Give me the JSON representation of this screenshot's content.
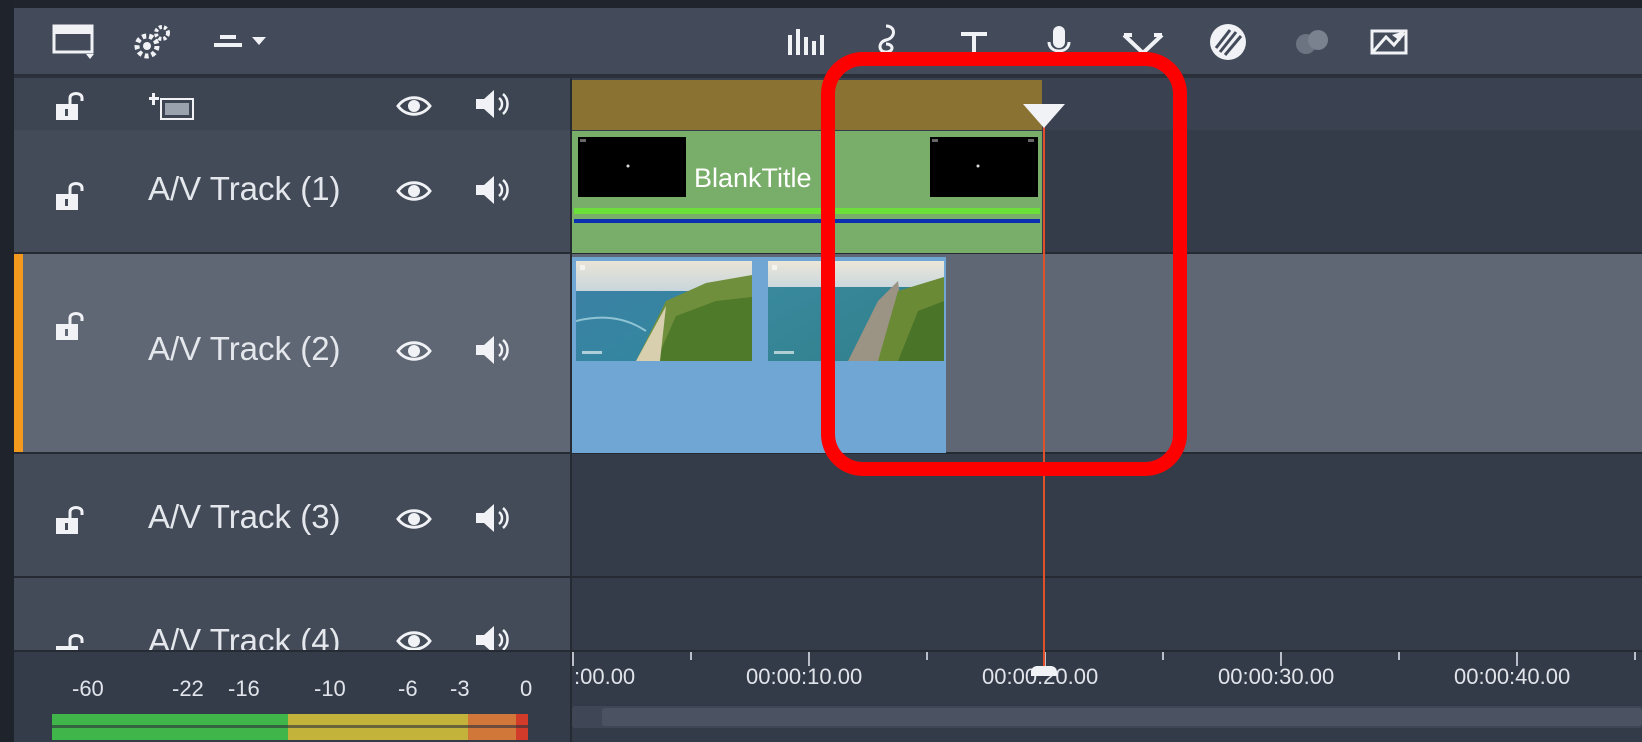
{
  "toolbar": {
    "left_icons": [
      "storyboard-view-icon",
      "settings-gear-icon",
      "track-options-dropdown-icon"
    ],
    "center_icons": [
      "audio-mixer-icon",
      "music-icon",
      "title-text-icon",
      "voiceover-mic-icon",
      "transition-icon",
      "color-grading-icon",
      "overlay-icon",
      "mask-icon"
    ]
  },
  "header": {
    "icons": [
      "lock-icon",
      "add-track-icon",
      "eye-icon",
      "speaker-icon"
    ]
  },
  "tracks": [
    {
      "name": "A/V Track (1)",
      "selected": false
    },
    {
      "name": "A/V Track (2)",
      "selected": true
    },
    {
      "name": "A/V Track (3)",
      "selected": false
    },
    {
      "name": "A/V Track (4)",
      "selected": false
    }
  ],
  "clips": {
    "title_clip_label": "BlankTitle"
  },
  "ruler": {
    "labels": [
      ":00.00",
      "00:00:10.00",
      "00:00:20.00",
      "00:00:30.00",
      "00:00:40.00"
    ]
  },
  "meter": {
    "labels": [
      "-60",
      "-22",
      "-16",
      "-10",
      "-6",
      "-3",
      "0"
    ]
  },
  "colors": {
    "annotation": "#ff0000",
    "playhead": "#e1502a",
    "title_clip": "#79ad6a",
    "video_clip": "#6fa6d4",
    "selected_accent": "#f39a1e"
  }
}
